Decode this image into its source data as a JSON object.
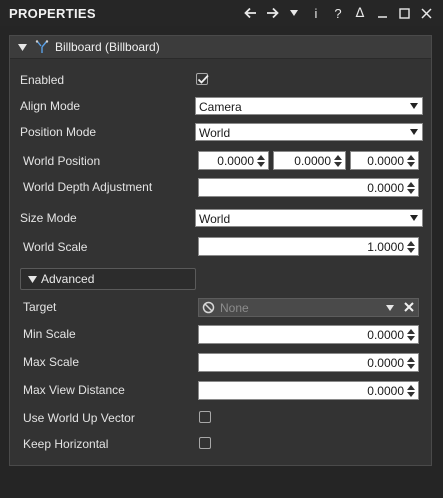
{
  "window": {
    "title": "PROPERTIES",
    "icons": [
      "back-arrow-icon",
      "forward-arrow-icon",
      "dropdown-caret-icon",
      "info-icon",
      "help-icon",
      "pin-icon",
      "minimize-icon",
      "maximize-icon",
      "close-icon"
    ],
    "toolbar_glyphs": {
      "info": "i",
      "help": "?",
      "pin": "ⵠ"
    }
  },
  "component": {
    "title": "Billboard (Billboard)",
    "icon": "billboard-icon",
    "expanded": true
  },
  "fields": {
    "enabled": {
      "label": "Enabled",
      "checked": true
    },
    "align_mode": {
      "label": "Align Mode",
      "value": "Camera"
    },
    "position_mode": {
      "label": "Position Mode",
      "value": "World"
    },
    "world_position": {
      "label": "World Position",
      "x": "0.0000",
      "y": "0.0000",
      "z": "0.0000"
    },
    "world_depth_adjustment": {
      "label": "World Depth Adjustment",
      "value": "0.0000"
    },
    "size_mode": {
      "label": "Size Mode",
      "value": "World"
    },
    "world_scale": {
      "label": "World Scale",
      "value": "1.0000"
    }
  },
  "advanced": {
    "label": "Advanced",
    "expanded": true,
    "target": {
      "label": "Target",
      "value": "None"
    },
    "min_scale": {
      "label": "Min Scale",
      "value": "0.0000"
    },
    "max_scale": {
      "label": "Max Scale",
      "value": "0.0000"
    },
    "max_view_distance": {
      "label": "Max View Distance",
      "value": "0.0000"
    },
    "use_world_up_vector": {
      "label": "Use World Up Vector",
      "checked": false
    },
    "keep_horizontal": {
      "label": "Keep Horizontal",
      "checked": false
    }
  }
}
